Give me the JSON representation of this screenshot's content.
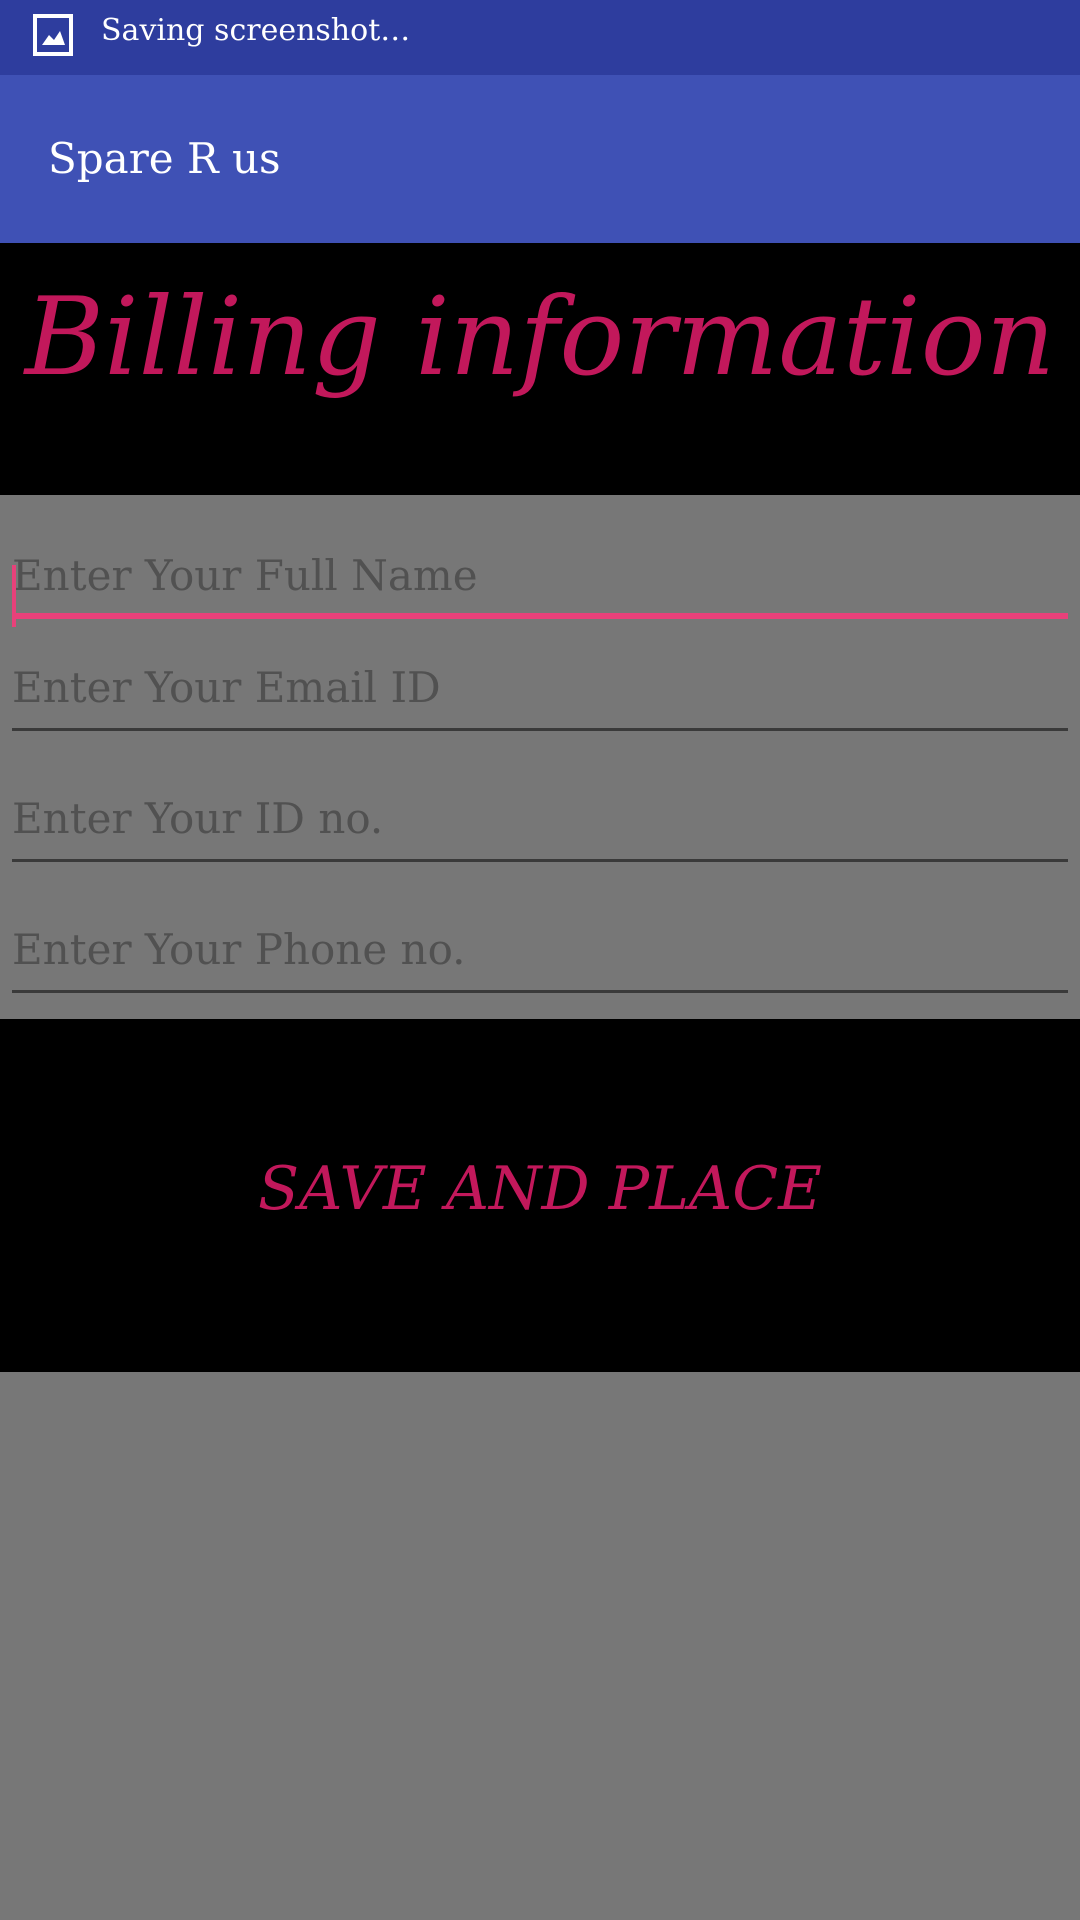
{
  "status_bar": {
    "notification_text": "Saving screenshot…",
    "icon": "image-icon"
  },
  "app_bar": {
    "title": "Spare R us"
  },
  "header": {
    "title": "Billing information"
  },
  "form": {
    "fields": [
      {
        "placeholder": "Enter Your Full Name",
        "value": "",
        "focused": true
      },
      {
        "placeholder": "Enter Your Email ID",
        "value": "",
        "focused": false
      },
      {
        "placeholder": "Enter Your ID no.",
        "value": "",
        "focused": false
      },
      {
        "placeholder": "Enter Your Phone no.",
        "value": "",
        "focused": false
      }
    ]
  },
  "actions": {
    "save_label": "SAVE AND PLACE"
  },
  "colors": {
    "status_bar": "#2E3D9E",
    "app_bar": "#3F51B5",
    "accent": "#E8417A",
    "title_pink": "#C2185B",
    "background": "#777777",
    "panel_black": "#000000"
  }
}
